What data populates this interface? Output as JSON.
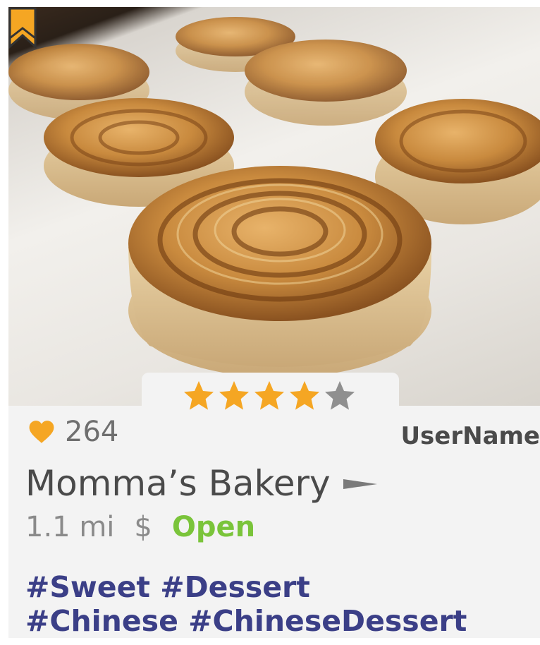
{
  "bookmark": {
    "icon": "bookmark-icon",
    "color": "#f5a623"
  },
  "rating": {
    "value": 4,
    "max": 5,
    "filled_color": "#f5a623",
    "empty_color": "#8f8f8f"
  },
  "likes": {
    "count": "264",
    "icon": "heart-icon",
    "color": "#f5a623"
  },
  "user": {
    "name": "UserName"
  },
  "restaurant": {
    "name": "Momma’s Bakery",
    "arrow_icon": "arrow-right-icon"
  },
  "details": {
    "distance": "1.1 mi",
    "price": "$",
    "status": "Open",
    "status_color": "#7ac43a"
  },
  "tags": {
    "line1": "#Sweet #Dessert",
    "line2": "#Chinese #ChineseDessert"
  }
}
